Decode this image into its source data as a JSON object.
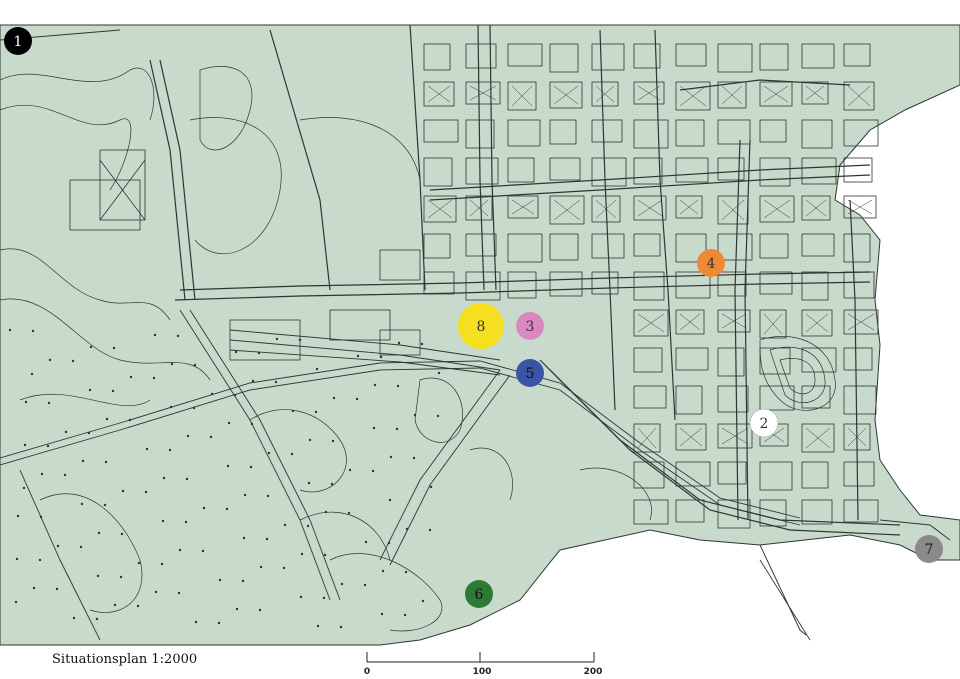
{
  "caption": "Situationsplan 1:2000",
  "scale_bar": {
    "labels": [
      "0",
      "100",
      "200"
    ]
  },
  "colors": {
    "land": "#c8dacb",
    "water": "#ffffff",
    "lines": "#2f3632"
  },
  "markers": [
    {
      "id": "1",
      "label": "1",
      "color": "#000000",
      "text_color": "#ffffff"
    },
    {
      "id": "2",
      "label": "2",
      "color": "#ffffff",
      "text_color": "#333333"
    },
    {
      "id": "3",
      "label": "3",
      "color": "#d989c0",
      "text_color": "#333333"
    },
    {
      "id": "4",
      "label": "4",
      "color": "#ee8a33",
      "text_color": "#333333"
    },
    {
      "id": "5",
      "label": "5",
      "color": "#3a55a4",
      "text_color": "#111111"
    },
    {
      "id": "6",
      "label": "6",
      "color": "#2e7a35",
      "text_color": "#111111"
    },
    {
      "id": "7",
      "label": "7",
      "color": "#8a8a8a",
      "text_color": "#222222"
    },
    {
      "id": "8",
      "label": "8",
      "color": "#f5e020",
      "text_color": "#333333"
    }
  ]
}
